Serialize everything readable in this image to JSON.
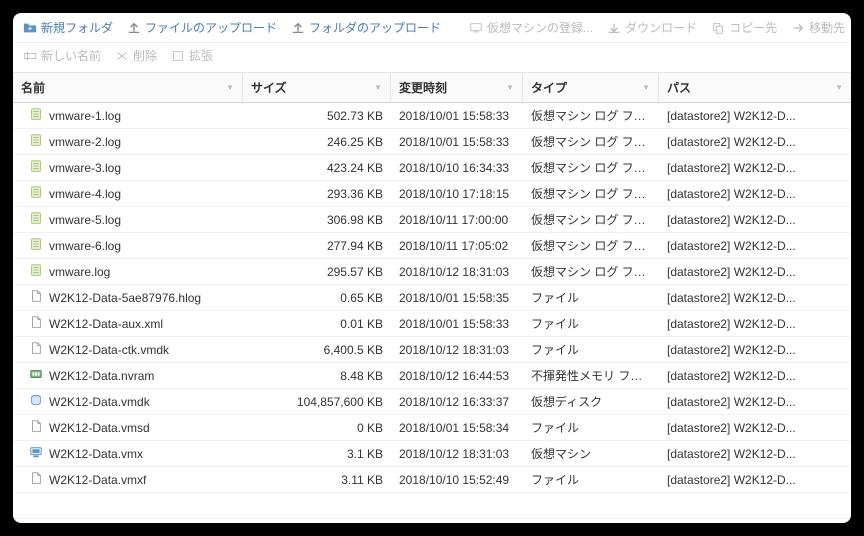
{
  "toolbar": {
    "new_folder": "新規フォルダ",
    "upload_file": "ファイルのアップロード",
    "upload_folder": "フォルダのアップロード",
    "register_vm": "仮想マシンの登録...",
    "download": "ダウンロード",
    "copy_to": "コピー先",
    "move_to": "移動先",
    "rename": "新しい名前",
    "delete": "削除",
    "expand": "拡張"
  },
  "columns": {
    "name": "名前",
    "size": "サイズ",
    "modified": "変更時刻",
    "type": "タイプ",
    "path": "パス"
  },
  "rows": [
    {
      "name": "vmware-1.log",
      "size": "502.73 KB",
      "date": "2018/10/01 15:58:33",
      "type": "仮想マシン ログ ファ...",
      "path": "[datastore2] W2K12-D...",
      "icon": "log"
    },
    {
      "name": "vmware-2.log",
      "size": "246.25 KB",
      "date": "2018/10/01 15:58:33",
      "type": "仮想マシン ログ ファ...",
      "path": "[datastore2] W2K12-D...",
      "icon": "log"
    },
    {
      "name": "vmware-3.log",
      "size": "423.24 KB",
      "date": "2018/10/10 16:34:33",
      "type": "仮想マシン ログ ファ...",
      "path": "[datastore2] W2K12-D...",
      "icon": "log"
    },
    {
      "name": "vmware-4.log",
      "size": "293.36 KB",
      "date": "2018/10/10 17:18:15",
      "type": "仮想マシン ログ ファ...",
      "path": "[datastore2] W2K12-D...",
      "icon": "log"
    },
    {
      "name": "vmware-5.log",
      "size": "306.98 KB",
      "date": "2018/10/11 17:00:00",
      "type": "仮想マシン ログ ファ...",
      "path": "[datastore2] W2K12-D...",
      "icon": "log"
    },
    {
      "name": "vmware-6.log",
      "size": "277.94 KB",
      "date": "2018/10/11 17:05:02",
      "type": "仮想マシン ログ ファ...",
      "path": "[datastore2] W2K12-D...",
      "icon": "log"
    },
    {
      "name": "vmware.log",
      "size": "295.57 KB",
      "date": "2018/10/12 18:31:03",
      "type": "仮想マシン ログ ファ...",
      "path": "[datastore2] W2K12-D...",
      "icon": "log"
    },
    {
      "name": "W2K12-Data-5ae87976.hlog",
      "size": "0.65 KB",
      "date": "2018/10/01 15:58:35",
      "type": "ファイル",
      "path": "[datastore2] W2K12-D...",
      "icon": "file"
    },
    {
      "name": "W2K12-Data-aux.xml",
      "size": "0.01 KB",
      "date": "2018/10/01 15:58:33",
      "type": "ファイル",
      "path": "[datastore2] W2K12-D...",
      "icon": "file"
    },
    {
      "name": "W2K12-Data-ctk.vmdk",
      "size": "6,400.5 KB",
      "date": "2018/10/12 18:31:03",
      "type": "ファイル",
      "path": "[datastore2] W2K12-D...",
      "icon": "file"
    },
    {
      "name": "W2K12-Data.nvram",
      "size": "8.48 KB",
      "date": "2018/10/12 16:44:53",
      "type": "不揮発性メモリ ファ...",
      "path": "[datastore2] W2K12-D...",
      "icon": "nvram"
    },
    {
      "name": "W2K12-Data.vmdk",
      "size": "104,857,600 KB",
      "date": "2018/10/12 16:33:37",
      "type": "仮想ディスク",
      "path": "[datastore2] W2K12-D...",
      "icon": "disk"
    },
    {
      "name": "W2K12-Data.vmsd",
      "size": "0 KB",
      "date": "2018/10/01 15:58:34",
      "type": "ファイル",
      "path": "[datastore2] W2K12-D...",
      "icon": "file"
    },
    {
      "name": "W2K12-Data.vmx",
      "size": "3.1 KB",
      "date": "2018/10/12 18:31:03",
      "type": "仮想マシン",
      "path": "[datastore2] W2K12-D...",
      "icon": "vmx"
    },
    {
      "name": "W2K12-Data.vmxf",
      "size": "3.11 KB",
      "date": "2018/10/10 15:52:49",
      "type": "ファイル",
      "path": "[datastore2] W2K12-D...",
      "icon": "file"
    }
  ]
}
